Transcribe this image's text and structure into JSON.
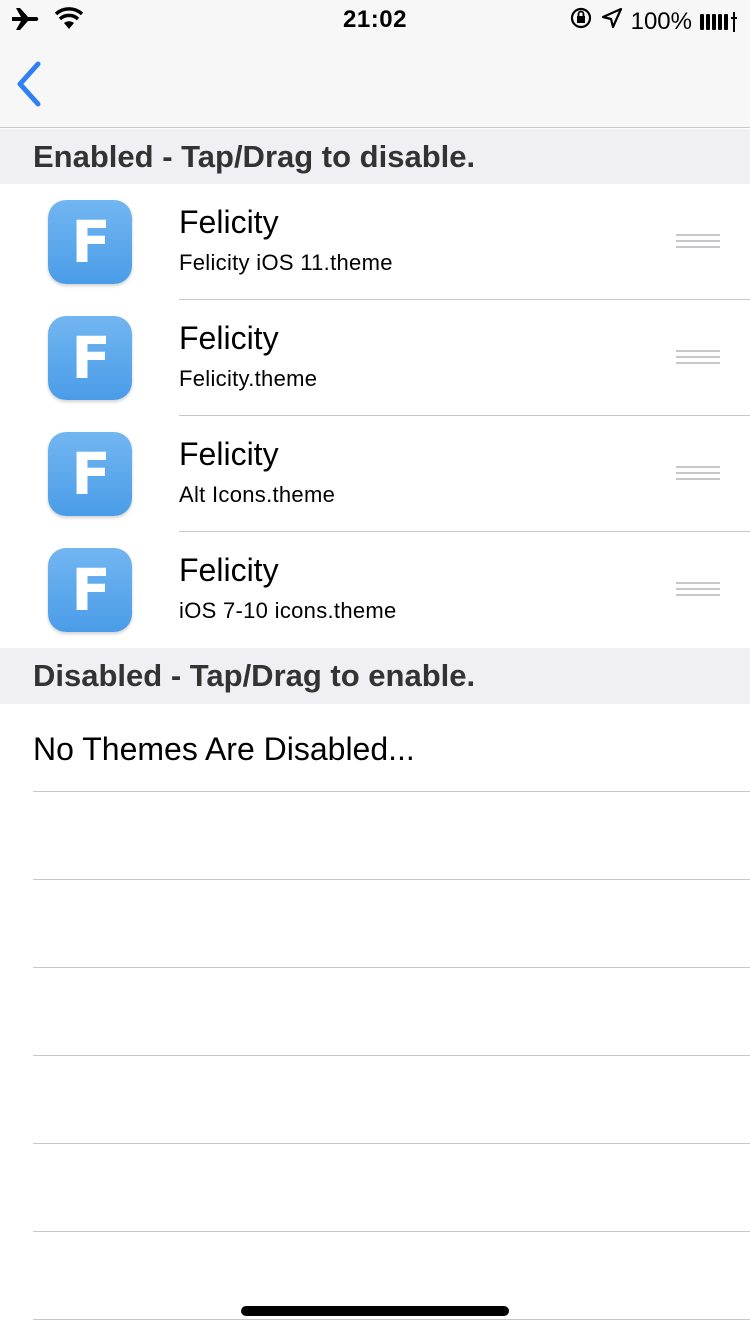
{
  "status_bar": {
    "time": "21:02",
    "battery_percent": "100%",
    "icons": [
      "airplane-icon",
      "wifi-icon",
      "orientation-lock-icon",
      "location-arrow-icon",
      "battery-icon"
    ]
  },
  "nav": {
    "back_icon": "chevron-left-icon",
    "accent": "#2f7ff5"
  },
  "enabled_section": {
    "header": "Enabled - Tap/Drag to disable.",
    "items": [
      {
        "icon_letter": "F",
        "title": "Felicity",
        "subtitle": "Felicity iOS 11.theme"
      },
      {
        "icon_letter": "F",
        "title": "Felicity",
        "subtitle": "Felicity.theme"
      },
      {
        "icon_letter": "F",
        "title": "Felicity",
        "subtitle": "Alt Icons.theme"
      },
      {
        "icon_letter": "F",
        "title": "Felicity",
        "subtitle": "iOS 7-10 icons.theme"
      }
    ]
  },
  "disabled_section": {
    "header": "Disabled - Tap/Drag to enable.",
    "empty_message": "No Themes Are Disabled..."
  },
  "colors": {
    "icon_blue": "#4a9ce8",
    "section_bg": "#efeff4",
    "separator": "#c8c7cc"
  }
}
